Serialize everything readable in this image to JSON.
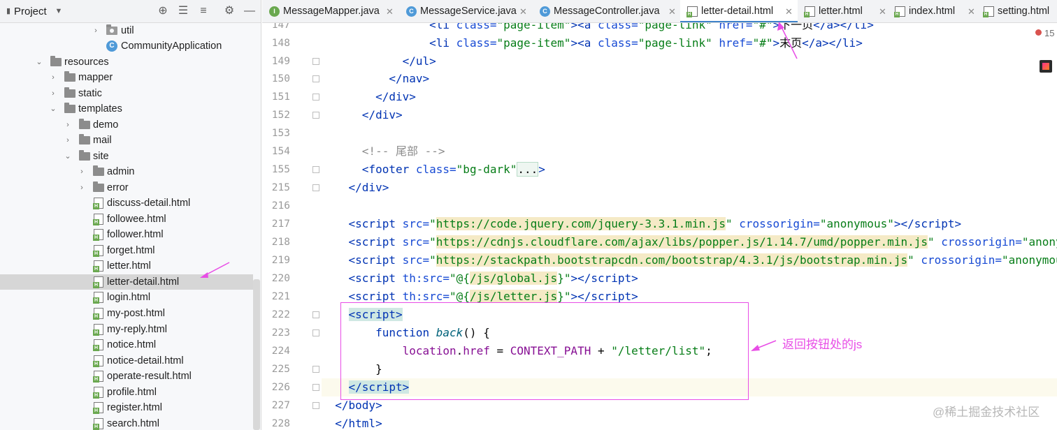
{
  "project_panel": {
    "title": "Project",
    "items": [
      {
        "label": "util",
        "kind": "package",
        "expanded": false
      },
      {
        "label": "CommunityApplication",
        "kind": "class"
      },
      {
        "label": "resources",
        "kind": "folder",
        "expanded": true
      },
      {
        "label": "mapper",
        "kind": "folder",
        "expanded": false
      },
      {
        "label": "static",
        "kind": "folder",
        "expanded": false
      },
      {
        "label": "templates",
        "kind": "folder",
        "expanded": true
      },
      {
        "label": "demo",
        "kind": "folder",
        "expanded": false
      },
      {
        "label": "mail",
        "kind": "folder",
        "expanded": false
      },
      {
        "label": "site",
        "kind": "folder",
        "expanded": true
      },
      {
        "label": "admin",
        "kind": "folder",
        "expanded": false
      },
      {
        "label": "error",
        "kind": "folder",
        "expanded": false
      },
      {
        "label": "discuss-detail.html",
        "kind": "html"
      },
      {
        "label": "followee.html",
        "kind": "html"
      },
      {
        "label": "follower.html",
        "kind": "html"
      },
      {
        "label": "forget.html",
        "kind": "html"
      },
      {
        "label": "letter.html",
        "kind": "html"
      },
      {
        "label": "letter-detail.html",
        "kind": "html",
        "selected": true
      },
      {
        "label": "login.html",
        "kind": "html"
      },
      {
        "label": "my-post.html",
        "kind": "html"
      },
      {
        "label": "my-reply.html",
        "kind": "html"
      },
      {
        "label": "notice.html",
        "kind": "html"
      },
      {
        "label": "notice-detail.html",
        "kind": "html"
      },
      {
        "label": "operate-result.html",
        "kind": "html"
      },
      {
        "label": "profile.html",
        "kind": "html"
      },
      {
        "label": "register.html",
        "kind": "html"
      },
      {
        "label": "search.html",
        "kind": "html"
      }
    ]
  },
  "tabs": [
    {
      "label": "MessageMapper.java",
      "icon": "interface-icon",
      "active": false
    },
    {
      "label": "MessageService.java",
      "icon": "class-icon",
      "active": false
    },
    {
      "label": "MessageController.java",
      "icon": "class-icon",
      "active": false
    },
    {
      "label": "letter-detail.html",
      "icon": "html-file-icon",
      "active": true
    },
    {
      "label": "letter.html",
      "icon": "html-file-icon",
      "active": false
    },
    {
      "label": "index.html",
      "icon": "html-file-icon",
      "active": false
    },
    {
      "label": "setting.html",
      "icon": "html-file-icon",
      "active": false
    }
  ],
  "editor": {
    "line_numbers": [
      "147",
      "148",
      "149",
      "150",
      "151",
      "152",
      "153",
      "154",
      "155",
      "215",
      "216",
      "217",
      "218",
      "219",
      "220",
      "221",
      "222",
      "223",
      "224",
      "225",
      "226",
      "227",
      "228"
    ],
    "error_count": "15",
    "current_line": "226"
  },
  "annotation": {
    "label": "返回按钮处的js",
    "color": "#e84de6"
  },
  "watermark": "@稀土掘金技术社区"
}
